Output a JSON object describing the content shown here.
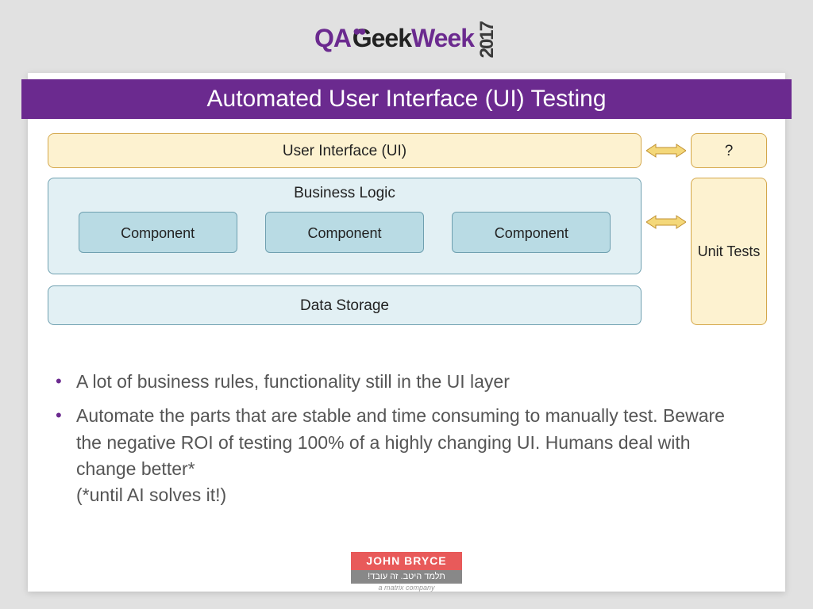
{
  "logo": {
    "part1": "QA",
    "part2": "Geek",
    "part3": "Week",
    "year": "2017"
  },
  "title": "Automated User Interface (UI) Testing",
  "diagram": {
    "ui_layer": "User Interface (UI)",
    "question": "?",
    "business": "Business Logic",
    "components": [
      "Component",
      "Component",
      "Component"
    ],
    "unit_tests": "Unit Tests",
    "data_storage": "Data Storage"
  },
  "bullets": [
    "A lot of business rules, functionality still in the UI layer",
    "Automate the parts that are stable and time consuming to manually test. Beware the negative ROI of testing 100% of a highly changing UI. Humans deal with change better*\n(*until AI solves it!)"
  ],
  "footer": {
    "line1": "JOHN BRYCE",
    "line2": "!תלמד היטב. זה עובד",
    "line3": "a matrix company"
  }
}
